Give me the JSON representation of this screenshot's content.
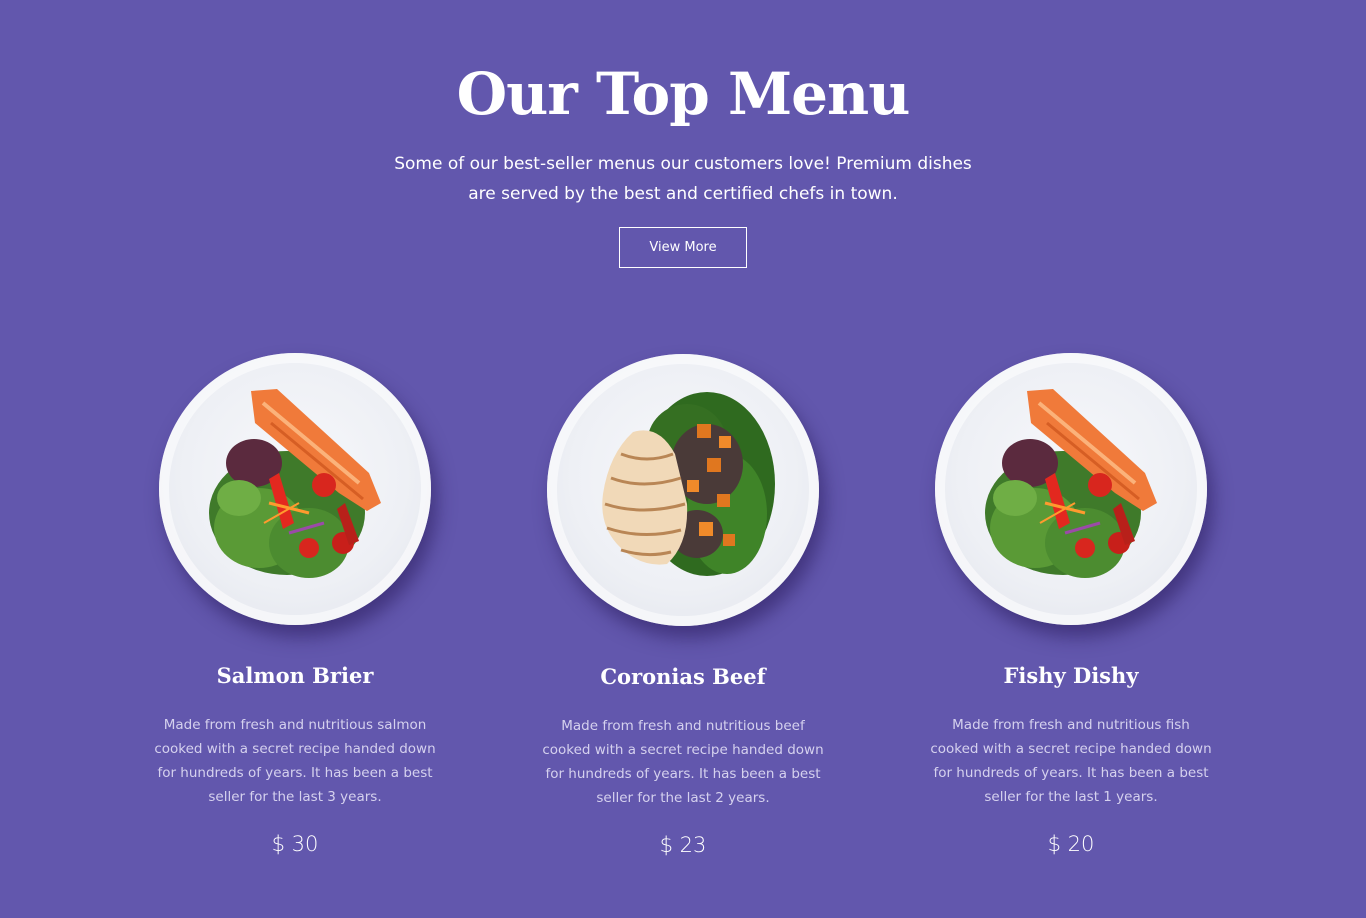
{
  "header": {
    "title": "Our Top Menu",
    "subtitle": "Some of our best-seller menus our customers love! Premium dishes are served by the best and certified chefs in town.",
    "view_more_label": "View More"
  },
  "menu": [
    {
      "name": "Salmon Brier",
      "description": "Made from fresh and nutritious salmon cooked with a secret recipe handed down for hundreds of years. It has been a best seller for the last 3 years.",
      "price": "$ 30",
      "image": "salmon-salad-plate"
    },
    {
      "name": "Coronias Beef",
      "description": "Made from fresh and nutritious beef cooked with a secret recipe handed down for hundreds of years. It has been a best seller for the last 2 years.",
      "price": "$ 23",
      "image": "sliced-meat-salad-plate"
    },
    {
      "name": "Fishy Dishy",
      "description": "Made from fresh and nutritious fish cooked with a secret recipe handed down for hundreds of years. It has been a best seller for the last 1 years.",
      "price": "$ 20",
      "image": "salmon-salad-plate"
    }
  ],
  "colors": {
    "background": "#6257ad",
    "text": "#ffffff",
    "muted_text": "#d5d1ee"
  }
}
